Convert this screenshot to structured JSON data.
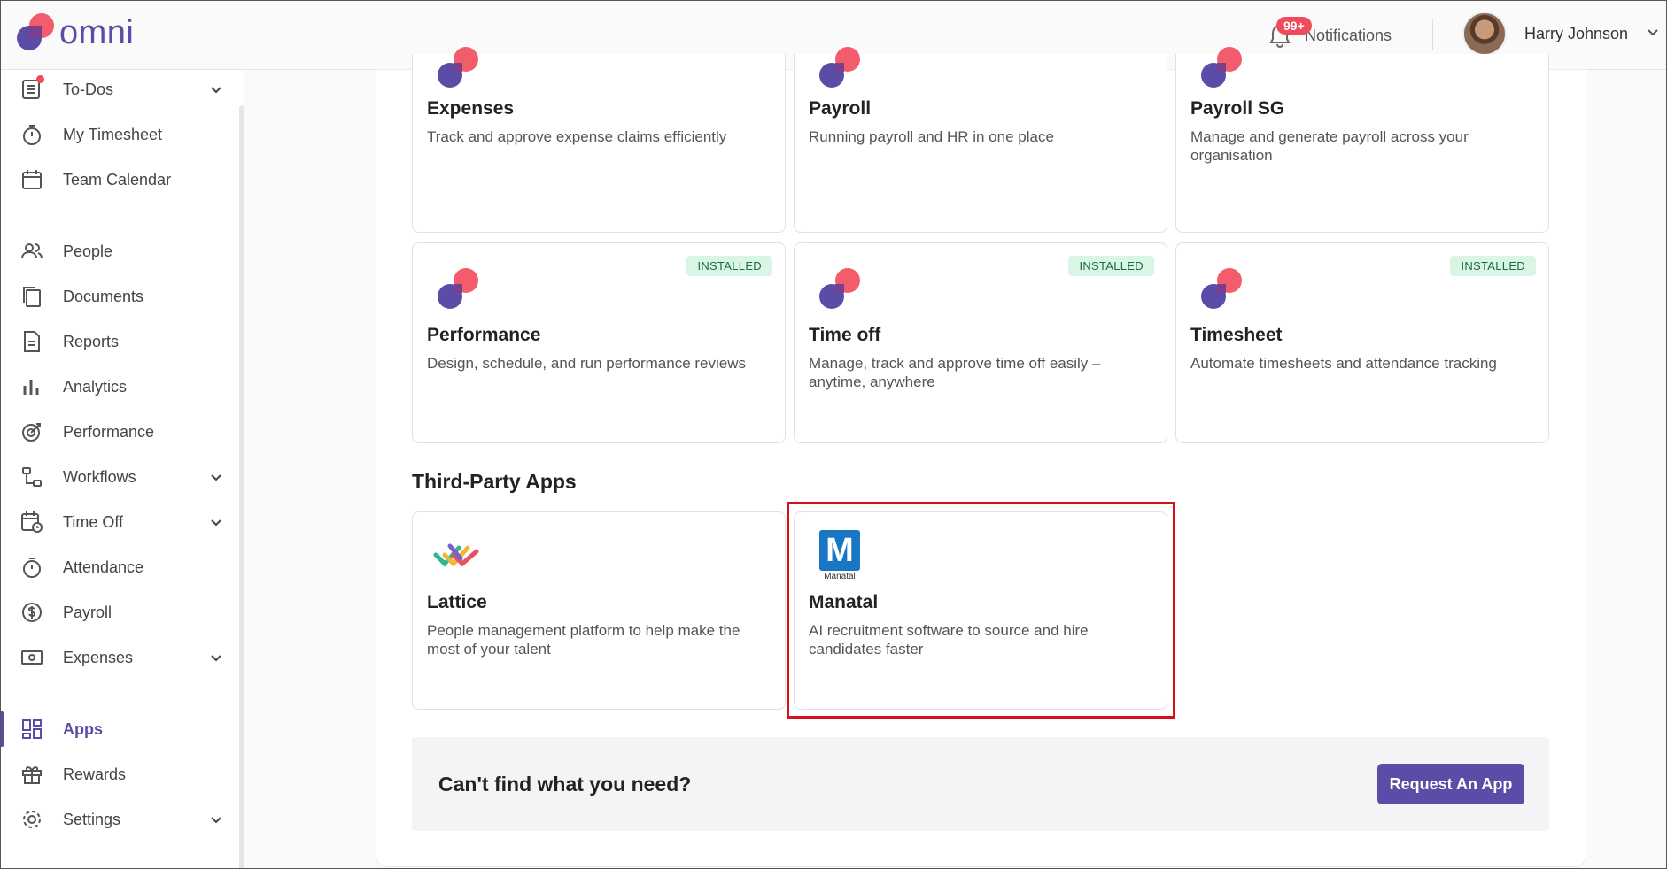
{
  "header": {
    "brand": "omni",
    "notifications_badge": "99+",
    "notifications_label": "Notifications",
    "user_name": "Harry Johnson"
  },
  "sidebar": {
    "items": [
      {
        "label": "To-Dos",
        "icon": "todo-list-icon",
        "has_chevron": true,
        "has_dot": true
      },
      {
        "label": "My Timesheet",
        "icon": "stopwatch-icon",
        "has_chevron": false
      },
      {
        "label": "Team Calendar",
        "icon": "calendar-icon",
        "has_chevron": false
      },
      {
        "label": "People",
        "icon": "people-icon",
        "has_chevron": false
      },
      {
        "label": "Documents",
        "icon": "documents-icon",
        "has_chevron": false
      },
      {
        "label": "Reports",
        "icon": "report-icon",
        "has_chevron": false
      },
      {
        "label": "Analytics",
        "icon": "bar-chart-icon",
        "has_chevron": false
      },
      {
        "label": "Performance",
        "icon": "target-icon",
        "has_chevron": false
      },
      {
        "label": "Workflows",
        "icon": "workflow-icon",
        "has_chevron": true
      },
      {
        "label": "Time Off",
        "icon": "calendar-clock-icon",
        "has_chevron": true
      },
      {
        "label": "Attendance",
        "icon": "stopwatch-icon",
        "has_chevron": false
      },
      {
        "label": "Payroll",
        "icon": "dollar-icon",
        "has_chevron": false
      },
      {
        "label": "Expenses",
        "icon": "cash-icon",
        "has_chevron": true
      },
      {
        "label": "Apps",
        "icon": "apps-grid-icon",
        "has_chevron": false,
        "active": true
      },
      {
        "label": "Rewards",
        "icon": "gift-icon",
        "has_chevron": false
      },
      {
        "label": "Settings",
        "icon": "gear-icon",
        "has_chevron": true
      }
    ]
  },
  "omni_apps": [
    {
      "title": "Expenses",
      "description": "Track and approve expense claims efficiently",
      "installed": false
    },
    {
      "title": "Payroll",
      "description": "Running payroll and HR in one place",
      "installed": false
    },
    {
      "title": "Payroll SG",
      "description": "Manage and generate payroll across your organisation",
      "installed": false
    },
    {
      "title": "Performance",
      "description": "Design, schedule, and run performance reviews",
      "installed": true
    },
    {
      "title": "Time off",
      "description": "Manage, track and approve time off easily – anytime, anywhere",
      "installed": true
    },
    {
      "title": "Timesheet",
      "description": "Automate timesheets and attendance tracking",
      "installed": true
    }
  ],
  "installed_label": "INSTALLED",
  "third_party": {
    "section_title": "Third-Party Apps",
    "apps": [
      {
        "title": "Lattice",
        "description": "People management platform to help make the most of your talent",
        "icon": "lattice-logo-icon"
      },
      {
        "title": "Manatal",
        "description": "AI recruitment software to source and hire candidates faster",
        "icon": "manatal-logo-icon",
        "logo_letter": "M",
        "logo_caption": "Manatal"
      }
    ]
  },
  "cta": {
    "text": "Can't find what you need?",
    "button_label": "Request An App"
  },
  "colors": {
    "brand_purple": "#5b4ca8",
    "brand_coral": "#f25c6b",
    "installed_bg": "#d8f5e5",
    "highlight_red": "#d8101c",
    "manatal_blue": "#1876c4"
  }
}
